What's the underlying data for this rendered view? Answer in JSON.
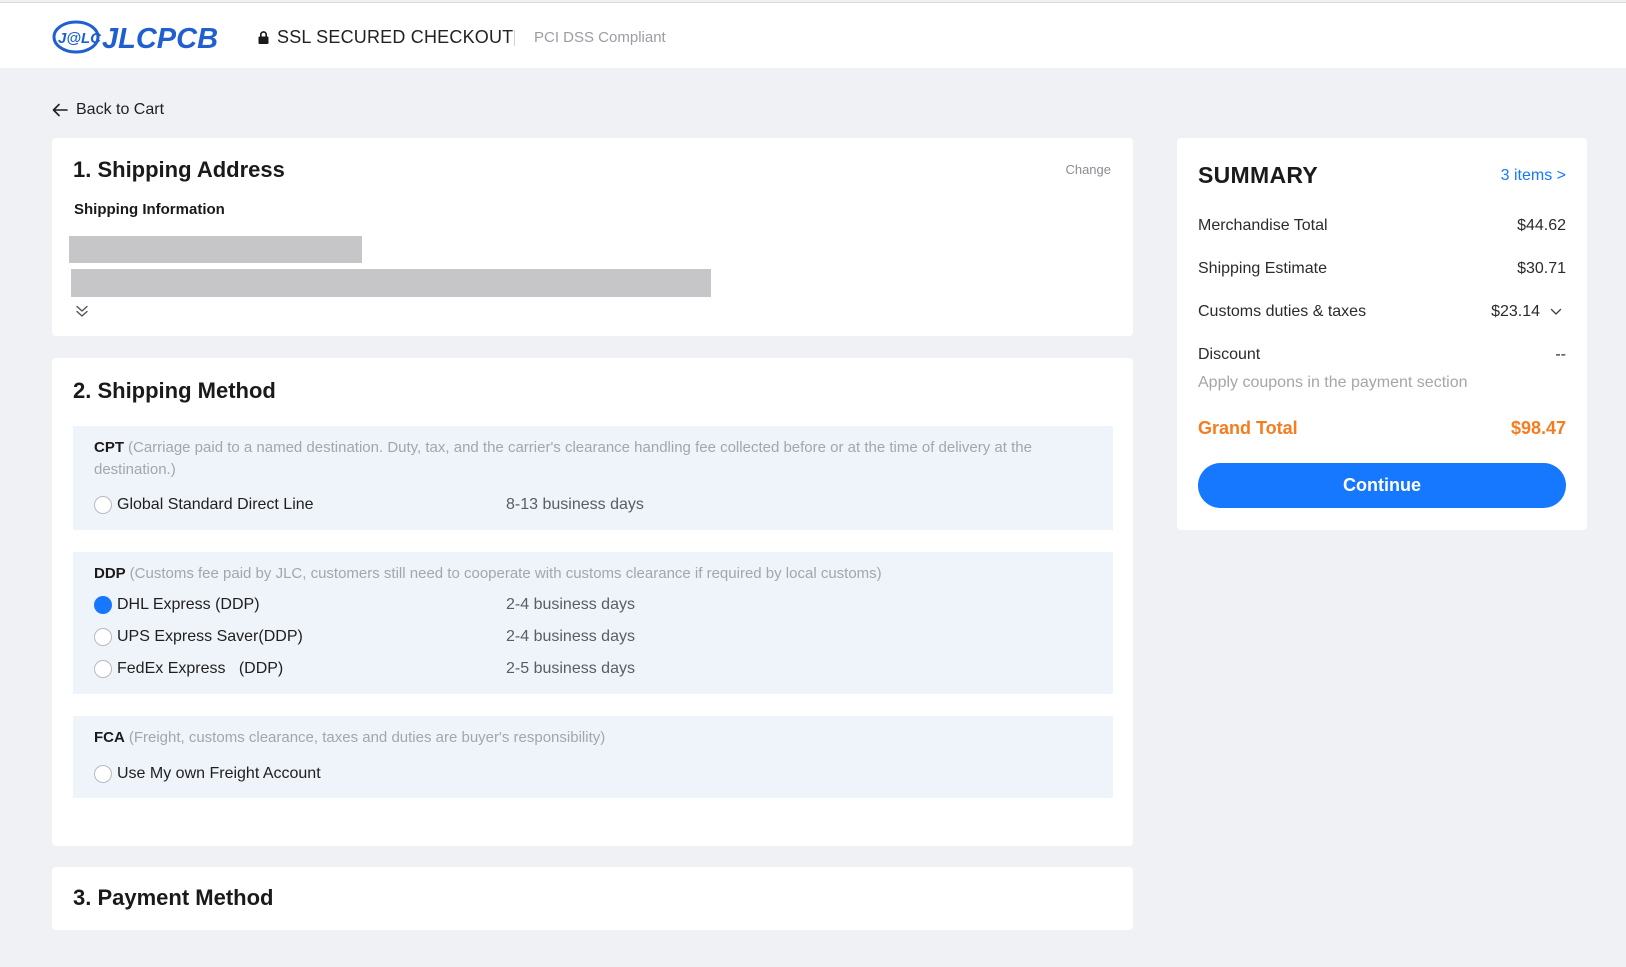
{
  "header": {
    "logo_text": "J@LC JLCPCB",
    "secure_label": "SSL SECURED CHECKOUT",
    "compliance_label": "PCI DSS Compliant"
  },
  "nav": {
    "back_label": "Back to Cart"
  },
  "shipping_address": {
    "title": "1. Shipping Address",
    "change_label": "Change",
    "info_label": "Shipping Information"
  },
  "shipping_method": {
    "title": "2. Shipping Method",
    "groups": [
      {
        "code": "CPT",
        "description": "(Carriage paid to a named destination. Duty, tax, and the carrier's clearance handling fee collected before or at the time of delivery at the destination.)",
        "options": [
          {
            "label": "Global Standard Direct Line",
            "days": "8-13 business days",
            "selected": false
          }
        ]
      },
      {
        "code": "DDP",
        "description": "(Customs fee paid by JLC, customers still need to cooperate with customs clearance if required by local customs)",
        "options": [
          {
            "label": "DHL Express (DDP)",
            "days": "2-4 business days",
            "selected": true
          },
          {
            "label": "UPS Express Saver(DDP)",
            "days": "2-4 business days",
            "selected": false
          },
          {
            "label": "FedEx Express   (DDP)",
            "days": "2-5 business days",
            "selected": false
          }
        ]
      },
      {
        "code": "FCA",
        "description": "(Freight, customs clearance, taxes and duties are buyer's responsibility)",
        "options": [
          {
            "label": "Use My own Freight Account",
            "days": "",
            "selected": false
          }
        ]
      }
    ]
  },
  "payment_method": {
    "title": "3. Payment Method"
  },
  "summary": {
    "title": "SUMMARY",
    "items_link": "3 items >",
    "merchandise_label": "Merchandise Total",
    "merchandise_value": "$44.62",
    "shipping_label": "Shipping Estimate",
    "shipping_value": "$30.71",
    "customs_label": "Customs duties & taxes",
    "customs_value": "$23.14",
    "discount_label": "Discount",
    "discount_value": "--",
    "coupon_note": "Apply coupons in the payment section",
    "grand_total_label": "Grand Total",
    "grand_total_value": "$98.47",
    "continue_label": "Continue"
  },
  "colors": {
    "accent": "#1677ff",
    "grand_total": "#f57c1f",
    "page_background": "#eff1f5",
    "group_background": "#eff4fa"
  },
  "icons": {
    "lock": "lock-icon",
    "back": "arrow-left-icon",
    "expand": "double-chevron-down-icon",
    "customs": "chevron-down-icon"
  }
}
